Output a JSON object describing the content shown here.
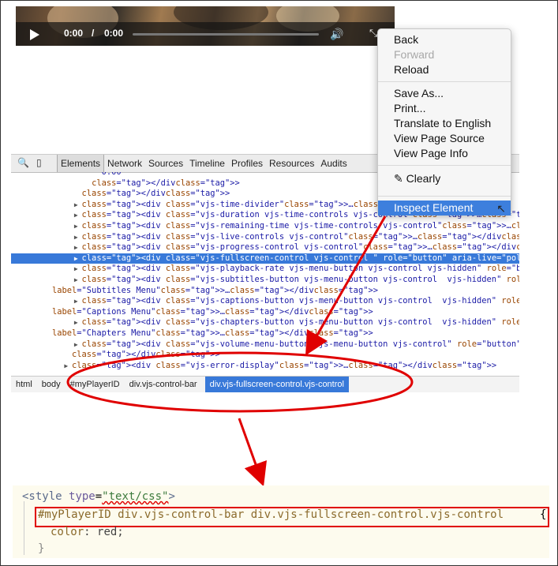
{
  "video": {
    "current_time": "0:00",
    "separator": "/",
    "duration": "0:00",
    "progress": 0
  },
  "devtools": {
    "tabs": [
      "Elements",
      "Network",
      "Sources",
      "Timeline",
      "Profiles",
      "Resources",
      "Audits"
    ],
    "active_tab": "Elements",
    "lines": [
      {
        "indent": 10,
        "tri": "",
        "html": "0.00"
      },
      {
        "indent": 8,
        "tri": "",
        "html": "</div>"
      },
      {
        "indent": 6,
        "tri": "",
        "html": "</div>"
      },
      {
        "indent": 6,
        "tri": "▶",
        "html": "<div class=\"vjs-time-divider\">…</div>"
      },
      {
        "indent": 6,
        "tri": "▶",
        "html": "<div class=\"vjs-duration vjs-time-controls vjs-control\">…</div>"
      },
      {
        "indent": 6,
        "tri": "▶",
        "html": "<div class=\"vjs-remaining-time vjs-time-controls vjs-control\">…</div>"
      },
      {
        "indent": 6,
        "tri": "▶",
        "html": "<div class=\"vjs-live-controls vjs-control\">…</div>"
      },
      {
        "indent": 6,
        "tri": "▶",
        "html": "<div class=\"vjs-progress-control vjs-control\">…</div>"
      },
      {
        "indent": 6,
        "tri": "▶",
        "html": "<div class=\"vjs-fullscreen-control vjs-control \" role=\"button\" aria-live=\"polite\" tabind",
        "selected": true
      },
      {
        "indent": 6,
        "tri": "▶",
        "html": "<div class=\"vjs-playback-rate vjs-menu-button vjs-control vjs-hidden\" role=\"button\" ari"
      },
      {
        "indent": 6,
        "tri": "▶",
        "html": "<div class=\"vjs-subtitles-button vjs-menu-button vjs-control  vjs-hidden\" role=\"button\""
      },
      {
        "indent": 0,
        "tri": "",
        "html": "label=\"Subtitles Menu\">…</div>"
      },
      {
        "indent": 6,
        "tri": "▶",
        "html": "<div class=\"vjs-captions-button vjs-menu-button vjs-control  vjs-hidden\" role=\"button\" a"
      },
      {
        "indent": 0,
        "tri": "",
        "html": "label=\"Captions Menu\">…</div>"
      },
      {
        "indent": 6,
        "tri": "▶",
        "html": "<div class=\"vjs-chapters-button vjs-menu-button vjs-control  vjs-hidden\" role=\"button\" a"
      },
      {
        "indent": 0,
        "tri": "",
        "html": "label=\"Chapters Menu\">…</div>"
      },
      {
        "indent": 6,
        "tri": "▶",
        "html": "<div class=\"vjs-volume-menu-button vjs-menu-button vjs-control\" role=\"button\" aria-live="
      },
      {
        "indent": 4,
        "tri": "",
        "html": "</div>"
      },
      {
        "indent": 4,
        "tri": "▶",
        "html": "<div class=\"vjs-error-display\">…</div>"
      }
    ],
    "breadcrumbs": [
      "html",
      "body",
      "#myPlayerID",
      "div.vjs-control-bar",
      "div.vjs-fullscreen-control.vjs-control"
    ],
    "active_breadcrumb": 4
  },
  "context_menu": {
    "items": [
      {
        "label": "Back"
      },
      {
        "label": "Forward",
        "disabled": true
      },
      {
        "label": "Reload"
      },
      {
        "sep": true
      },
      {
        "label": "Save As..."
      },
      {
        "label": "Print..."
      },
      {
        "label": "Translate to English"
      },
      {
        "label": "View Page Source"
      },
      {
        "label": "View Page Info"
      },
      {
        "sep": true
      },
      {
        "label": "Clearly",
        "icon": true
      },
      {
        "sep": true
      },
      {
        "label": "Inspect Element",
        "highlight": true
      }
    ]
  },
  "snippet": {
    "open_tag": "<style",
    "attr": "type",
    "attr_val": "\"text/css\"",
    "close": ">",
    "selector": "#myPlayerID div.vjs-control-bar div.vjs-fullscreen-control.vjs-control",
    "brace_open": "{",
    "property": "color",
    "value": "red;",
    "brace_close": "}"
  },
  "colors": {
    "annotation": "#e00000",
    "selection": "#3879d9",
    "menu_highlight": "#3d7fdd"
  }
}
